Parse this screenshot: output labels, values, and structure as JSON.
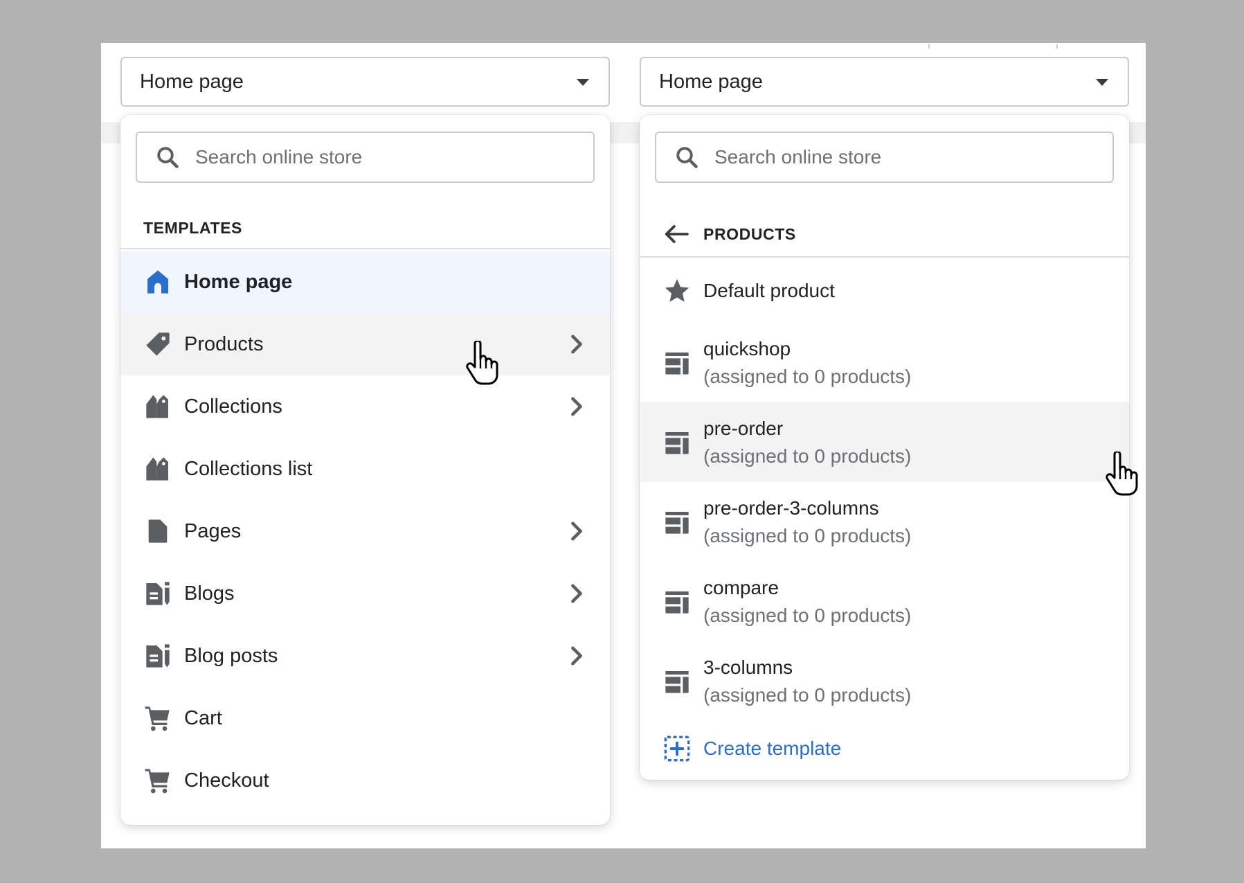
{
  "left_panel": {
    "select_value": "Home page",
    "search_placeholder": "Search online store",
    "section_title": "TEMPLATES",
    "items": [
      {
        "label": "Home page",
        "icon": "home-icon"
      },
      {
        "label": "Products",
        "icon": "tag-icon"
      },
      {
        "label": "Collections",
        "icon": "collections-icon"
      },
      {
        "label": "Collections list",
        "icon": "collections-icon"
      },
      {
        "label": "Pages",
        "icon": "page-icon"
      },
      {
        "label": "Blogs",
        "icon": "blog-icon"
      },
      {
        "label": "Blog posts",
        "icon": "blog-icon"
      },
      {
        "label": "Cart",
        "icon": "cart-icon"
      },
      {
        "label": "Checkout",
        "icon": "cart-icon"
      }
    ]
  },
  "right_panel": {
    "select_value": "Home page",
    "search_placeholder": "Search online store",
    "section_title": "PRODUCTS",
    "default_item": {
      "label": "Default product",
      "icon": "star-icon"
    },
    "templates": [
      {
        "name": "quickshop",
        "assigned": "(assigned to 0 products)",
        "icon": "template-layout-icon"
      },
      {
        "name": "pre-order",
        "assigned": "(assigned to 0 products)",
        "icon": "template-layout-icon"
      },
      {
        "name": "pre-order-3-columns",
        "assigned": "(assigned to 0 products)",
        "icon": "template-layout-icon"
      },
      {
        "name": "compare",
        "assigned": "(assigned to 0 products)",
        "icon": "template-layout-icon"
      },
      {
        "name": "3-columns",
        "assigned": "(assigned to 0 products)",
        "icon": "template-layout-icon"
      }
    ],
    "create_label": "Create template"
  },
  "colors": {
    "background": "#b3b3b3",
    "selected_row": "#f1f5fd",
    "hover_row": "#f3f3f3",
    "home_icon": "#2c6ecb",
    "link": "#2c6ecb",
    "icon": "#5c5f62"
  }
}
